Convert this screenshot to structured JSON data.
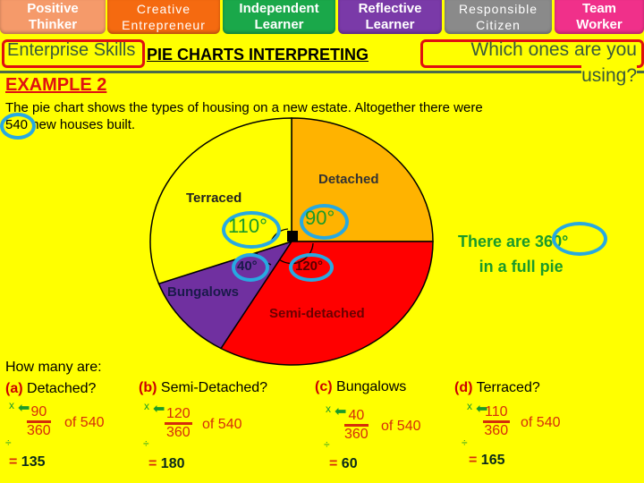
{
  "skills_tabs": [
    {
      "label_line1": "Positive",
      "label_line2": "Thinker",
      "color": "#f59a6a"
    },
    {
      "label_line1": "Creative",
      "label_line2": "Entrepreneur",
      "color": "#f56a10"
    },
    {
      "label_line1": "Independent",
      "label_line2": "Learner",
      "color": "#1aa84a"
    },
    {
      "label_line1": "Reflective",
      "label_line2": "Learner",
      "color": "#7a3aa8"
    },
    {
      "label_line1": "Responsible",
      "label_line2": "Citizen",
      "color": "#8a8a8a"
    },
    {
      "label_line1": "Team",
      "label_line2": "Worker",
      "color": "#f0308a"
    }
  ],
  "header": {
    "enterprise_label": "Enterprise Skills",
    "title": "PIE CHARTS INTERPRETING",
    "which_ones": "Which ones are you",
    "using": "using?",
    "example": "EXAMPLE 2"
  },
  "intro": {
    "line1": "The pie chart shows the types of housing on a new estate. Altogether there were",
    "line2_number": "540",
    "line2_rest": " new houses built."
  },
  "note": {
    "prefix": "There are ",
    "degrees": "360°",
    "line2": "in a full pie"
  },
  "chart_data": {
    "type": "pie",
    "title": "Types of housing on a new estate",
    "total": 540,
    "units": "degrees",
    "slices": [
      {
        "label": "Detached",
        "angle_label": "90°",
        "value": 90,
        "color": "#ffb300"
      },
      {
        "label": "Semi-detached",
        "angle_label": "120°",
        "value": 120,
        "color": "#ff0000"
      },
      {
        "label": "Bungalows",
        "angle_label": "40°",
        "value": 40,
        "color": "#7030a0"
      },
      {
        "label": "Terraced",
        "angle_label": "110°",
        "value": 110,
        "color": "#ffff00"
      }
    ],
    "start": "12 o'clock",
    "direction": "clockwise"
  },
  "questions": {
    "heading": "How many are:",
    "items": [
      {
        "letter": "(a)",
        "text": "Detached?",
        "numerator": "90",
        "denominator": "360",
        "of": "of 540",
        "result": "135"
      },
      {
        "letter": "(b)",
        "text": "Semi-Detached?",
        "numerator": "120",
        "denominator": "360",
        "of": "of 540",
        "result": "180"
      },
      {
        "letter": "(c)",
        "text": "Bungalows",
        "numerator": "40",
        "denominator": "360",
        "of": "of 540",
        "result": "60"
      },
      {
        "letter": "(d)",
        "text": "Terraced?",
        "numerator": "110",
        "denominator": "360",
        "of": "of 540",
        "result": "165"
      }
    ],
    "multiply_symbol": "x",
    "divide_symbol": "÷",
    "equals": "="
  }
}
